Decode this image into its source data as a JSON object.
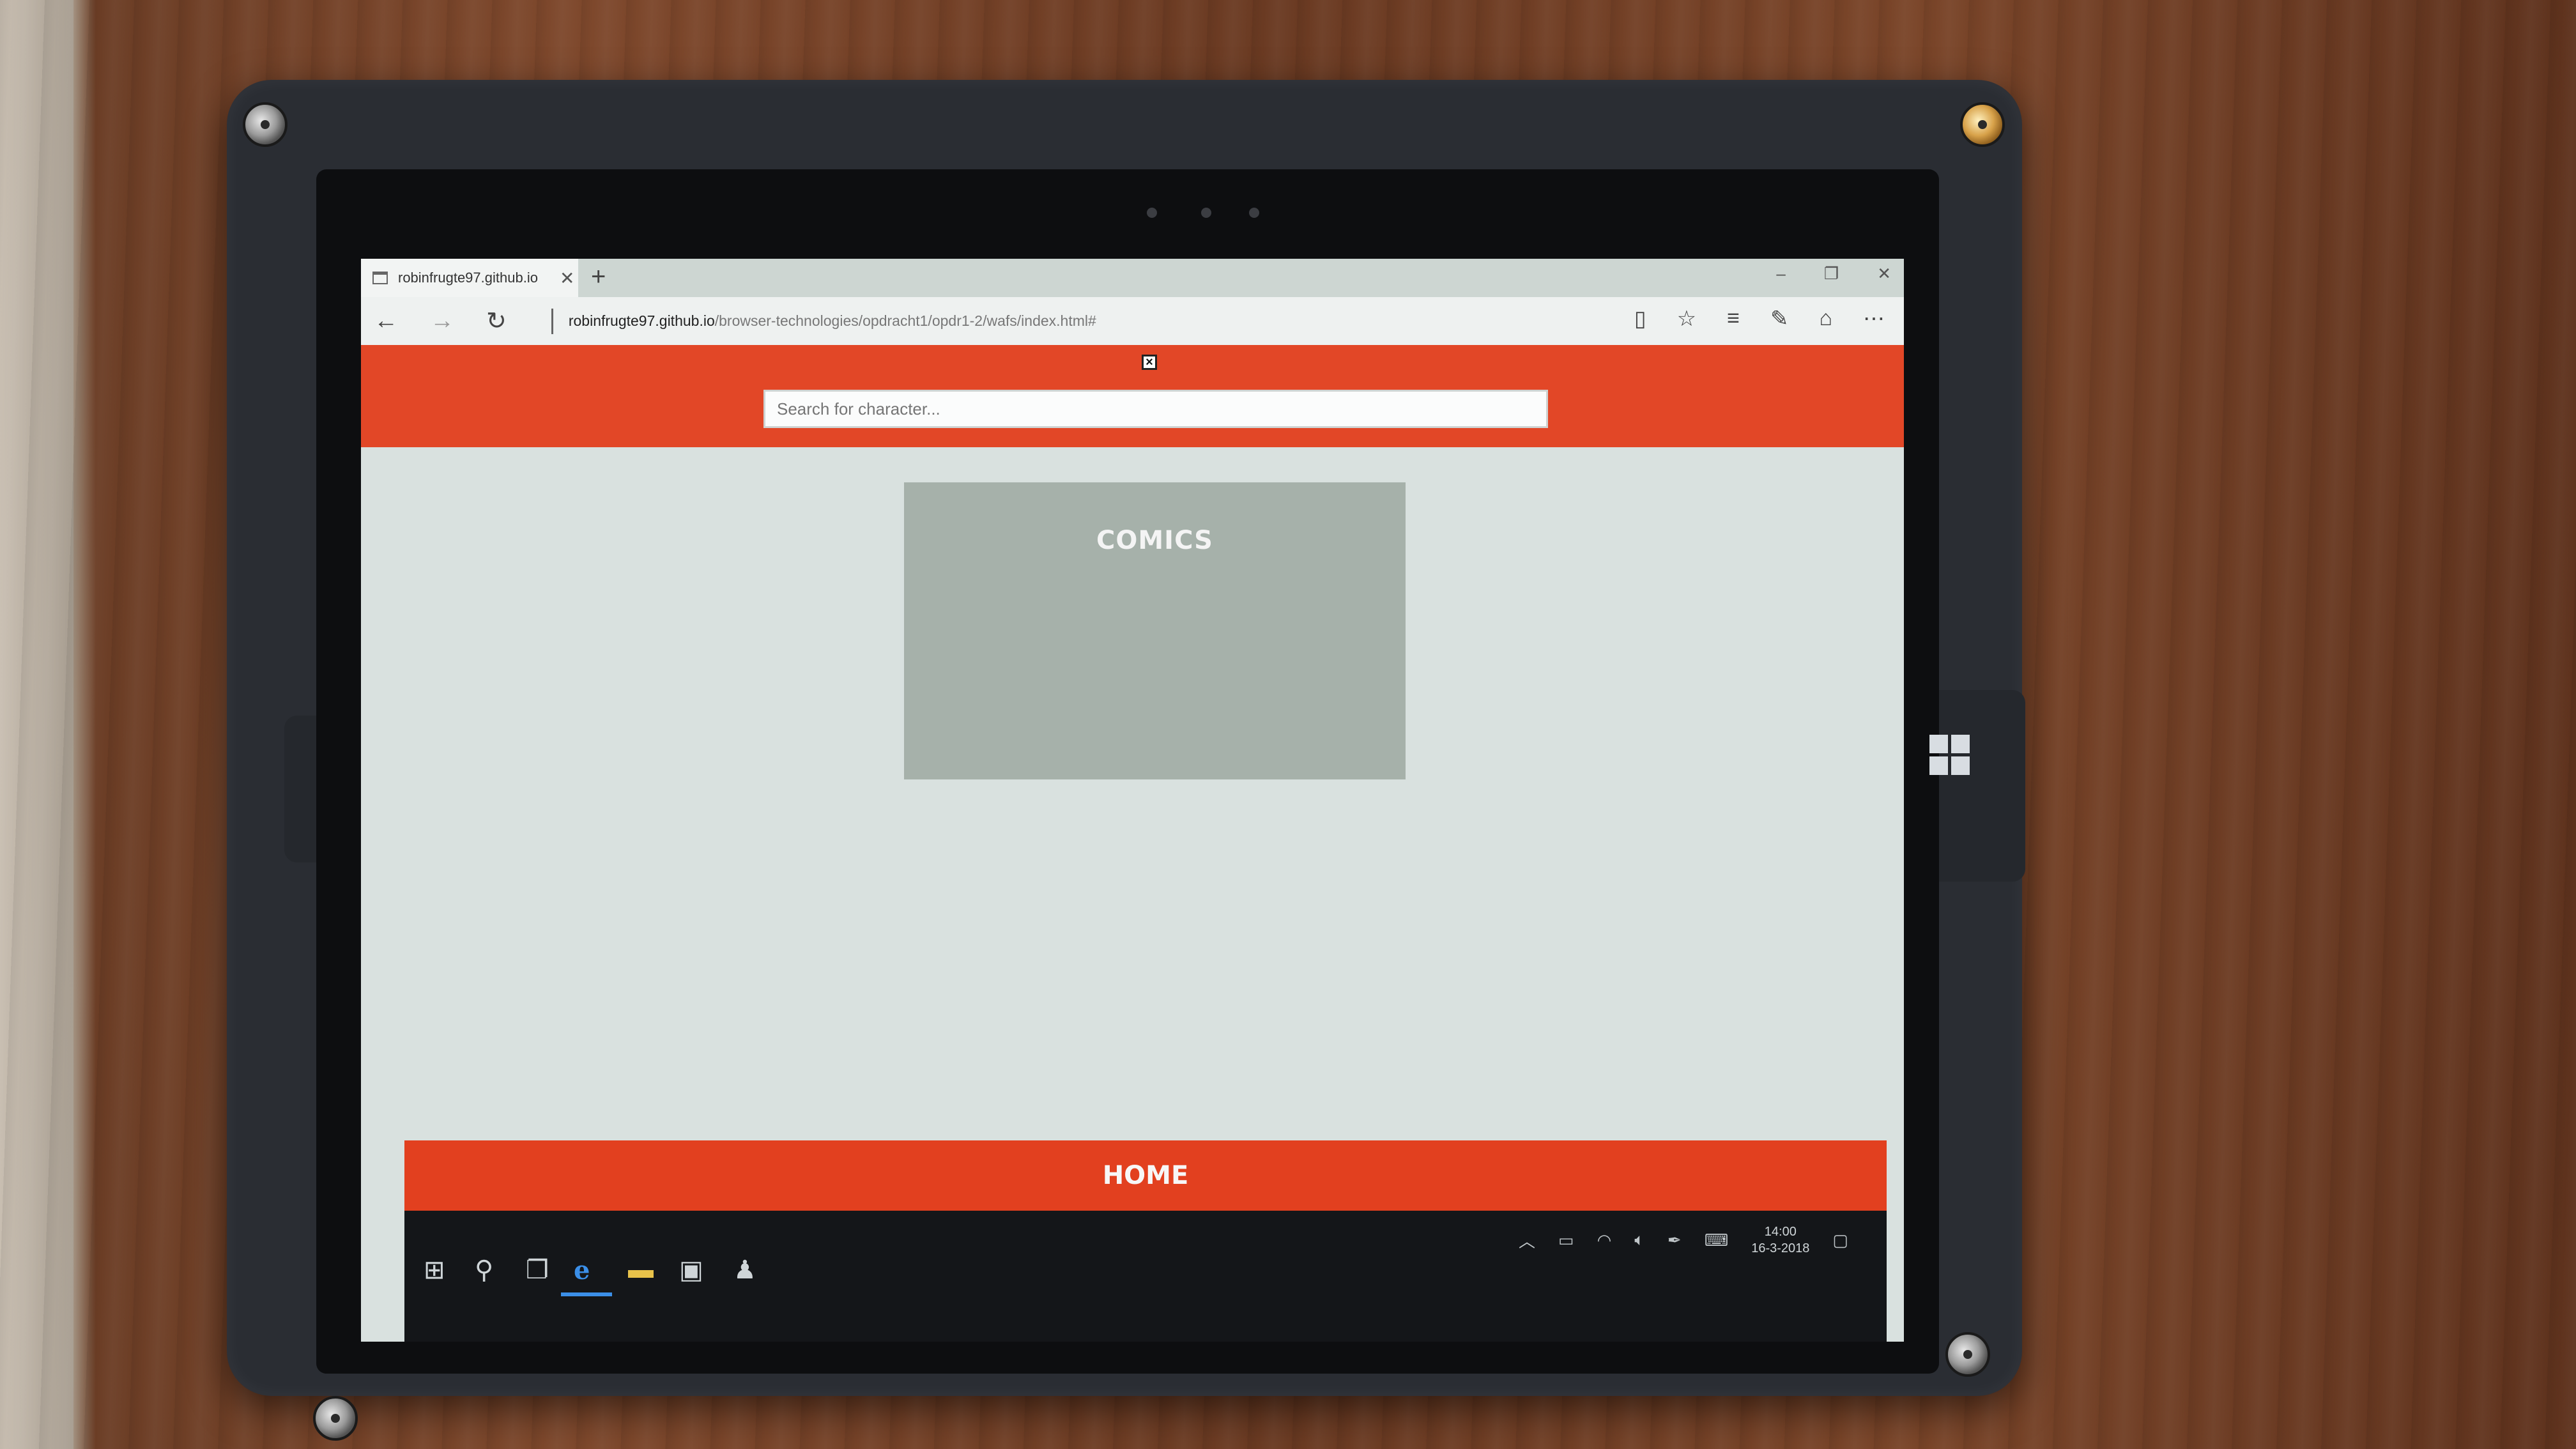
{
  "browser": {
    "tab_title": "robinfrugte97.github.io",
    "tab_close": "✕",
    "new_tab": "+",
    "window_controls": [
      "–",
      "❐",
      "✕"
    ],
    "url_host": "robinfrugte97.github.io",
    "url_path": "/browser-technologies/opdracht1/opdr1-2/wafs/index.html#",
    "nav": {
      "back": "←",
      "forward": "→",
      "refresh": "↻"
    },
    "toolbar_icons": [
      "reading-view-icon",
      "favorite-star-icon",
      "hub-icon",
      "web-note-icon",
      "share-icon",
      "more-icon"
    ]
  },
  "page": {
    "close_label": "×",
    "search_placeholder": "Search for character...",
    "card_title": "COMICS",
    "footer_label": "HOME",
    "colors": {
      "header": "#e24727",
      "card": "#a6b1aa",
      "background": "#d9e1df"
    }
  },
  "taskbar": {
    "time": "14:00",
    "date": "16-3-2018",
    "icons": [
      "start-icon",
      "search-icon",
      "task-view-icon",
      "edge-icon",
      "file-explorer-icon",
      "store-icon",
      "app-icon"
    ]
  }
}
